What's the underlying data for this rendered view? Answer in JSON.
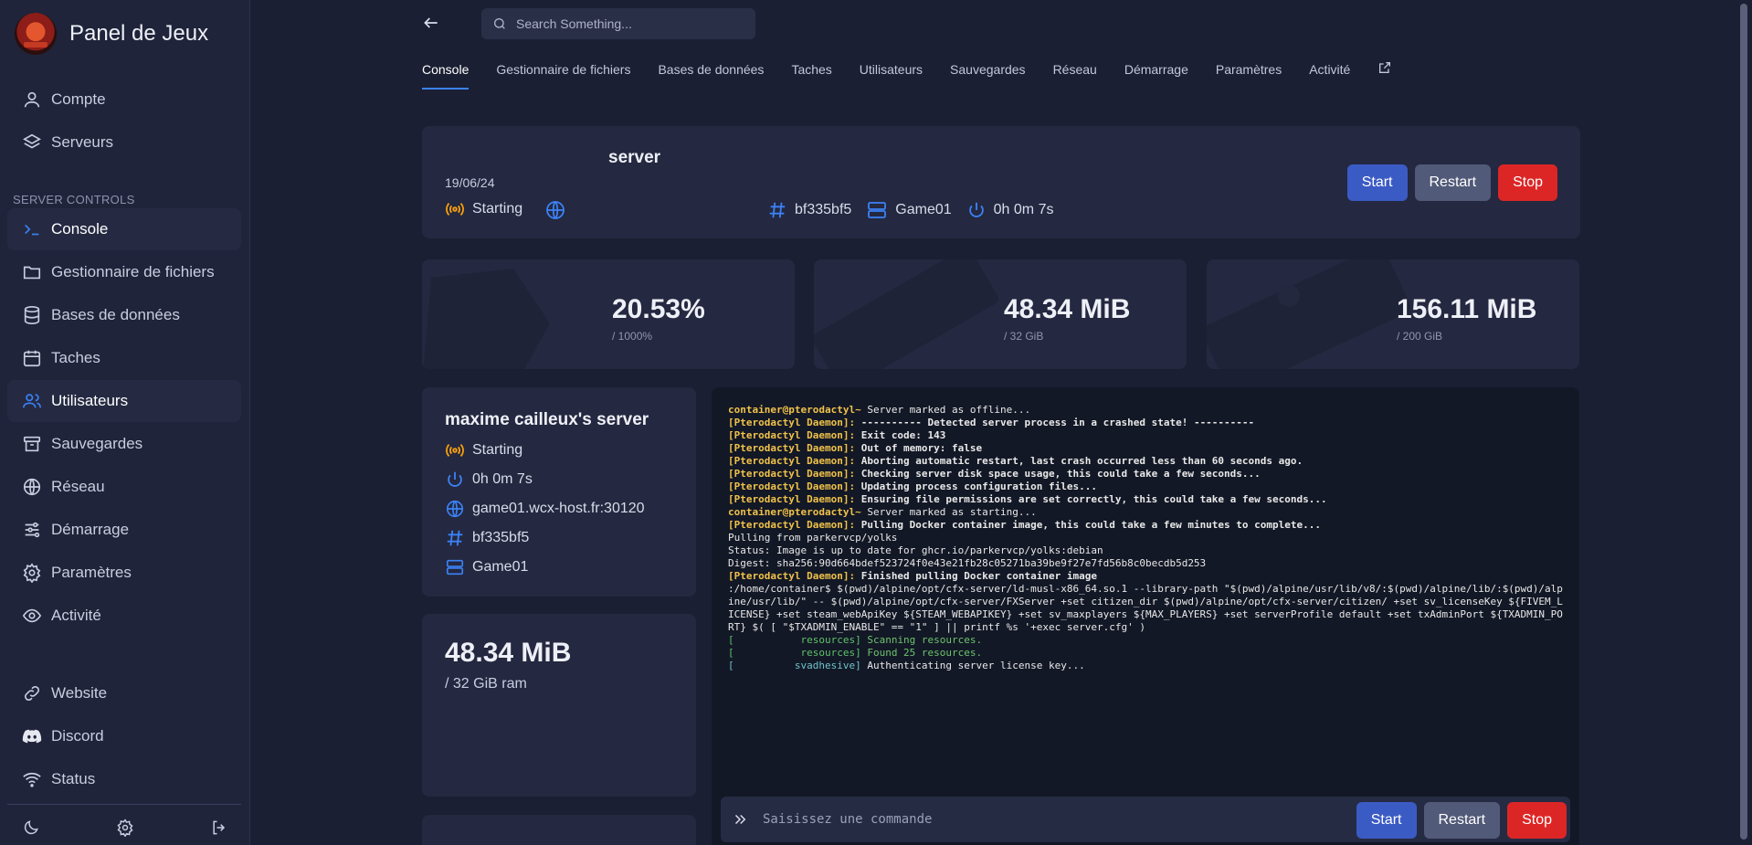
{
  "brand": {
    "title": "Panel de Jeux"
  },
  "sidebar": {
    "top_items": [
      {
        "label": "Compte",
        "icon": "user-icon"
      },
      {
        "label": "Serveurs",
        "icon": "layers-icon"
      }
    ],
    "section_label": "SERVER CONTROLS",
    "items": [
      {
        "label": "Console",
        "icon": "terminal-icon",
        "active": true
      },
      {
        "label": "Gestionnaire de fichiers",
        "icon": "folder-icon"
      },
      {
        "label": "Bases de données",
        "icon": "database-icon"
      },
      {
        "label": "Taches",
        "icon": "calendar-icon"
      },
      {
        "label": "Utilisateurs",
        "icon": "users-icon",
        "highlight": true
      },
      {
        "label": "Sauvegardes",
        "icon": "archive-icon"
      },
      {
        "label": "Réseau",
        "icon": "globe-icon"
      },
      {
        "label": "Démarrage",
        "icon": "sliders-icon"
      },
      {
        "label": "Paramètres",
        "icon": "gear-icon"
      },
      {
        "label": "Activité",
        "icon": "eye-icon"
      }
    ],
    "footer_items": [
      {
        "label": "Website",
        "icon": "link-icon"
      },
      {
        "label": "Discord",
        "icon": "discord-icon"
      },
      {
        "label": "Status",
        "icon": "wifi-icon"
      }
    ]
  },
  "search": {
    "placeholder": "Search Something..."
  },
  "tabs": [
    "Console",
    "Gestionnaire de fichiers",
    "Bases de données",
    "Taches",
    "Utilisateurs",
    "Sauvegardes",
    "Réseau",
    "Démarrage",
    "Paramètres",
    "Activité"
  ],
  "header": {
    "name": "server",
    "date": "19/06/24",
    "status": "Starting",
    "id": "bf335bf5",
    "node": "Game01",
    "uptime": "0h 0m 7s",
    "buttons": {
      "start": "Start",
      "restart": "Restart",
      "stop": "Stop"
    }
  },
  "stats": [
    {
      "value": "20.53%",
      "sub": "/ 1000%"
    },
    {
      "value": "48.34 MiB",
      "sub": "/ 32 GiB"
    },
    {
      "value": "156.11 MiB",
      "sub": "/ 200 GiB"
    }
  ],
  "info": {
    "title": "maxime cailleux's server",
    "status": "Starting",
    "uptime": "0h 0m 7s",
    "address": "game01.wcx-host.fr:30120",
    "id": "bf335bf5",
    "node": "Game01"
  },
  "memory": {
    "value": "48.34 MiB",
    "sub": "/ 32 GiB ram"
  },
  "console": {
    "lines": [
      {
        "prefix": "container@pterodactyl~",
        "text": " Server marked as offline...",
        "style": "prompt"
      },
      {
        "prefix": "[Pterodactyl Daemon]:",
        "text": " ---------- Detected server process in a crashed state! ----------",
        "style": "daemon"
      },
      {
        "prefix": "[Pterodactyl Daemon]:",
        "text": " Exit code: 143",
        "style": "daemon"
      },
      {
        "prefix": "[Pterodactyl Daemon]:",
        "text": " Out of memory: false",
        "style": "daemon"
      },
      {
        "prefix": "[Pterodactyl Daemon]:",
        "text": " Aborting automatic restart, last crash occurred less than 60 seconds ago.",
        "style": "daemon"
      },
      {
        "prefix": "[Pterodactyl Daemon]:",
        "text": " Checking server disk space usage, this could take a few seconds...",
        "style": "daemon"
      },
      {
        "prefix": "[Pterodactyl Daemon]:",
        "text": " Updating process configuration files...",
        "style": "daemon"
      },
      {
        "prefix": "[Pterodactyl Daemon]:",
        "text": " Ensuring file permissions are set correctly, this could take a few seconds...",
        "style": "daemon"
      },
      {
        "prefix": "container@pterodactyl~",
        "text": " Server marked as starting...",
        "style": "prompt"
      },
      {
        "prefix": "[Pterodactyl Daemon]:",
        "text": " Pulling Docker container image, this could take a few minutes to complete...",
        "style": "daemon"
      },
      {
        "prefix": "",
        "text": "Pulling from parkervcp/yolks",
        "style": "plain"
      },
      {
        "prefix": "",
        "text": "Status: Image is up to date for ghcr.io/parkervcp/yolks:debian",
        "style": "plain"
      },
      {
        "prefix": "",
        "text": "Digest: sha256:90d664bdef523724f0e43e21fb28c05271ba39be9f27e7fd56b8c0becdb5d253",
        "style": "plain"
      },
      {
        "prefix": "[Pterodactyl Daemon]:",
        "text": " Finished pulling Docker container image",
        "style": "daemon"
      },
      {
        "prefix": "",
        "text": ":/home/container$ $(pwd)/alpine/opt/cfx-server/ld-musl-x86_64.so.1 --library-path \"$(pwd)/alpine/usr/lib/v8/:$(pwd)/alpine/lib/:$(pwd)/alpine/usr/lib/\" -- $(pwd)/alpine/opt/cfx-server/FXServer +set citizen_dir $(pwd)/alpine/opt/cfx-server/citizen/ +set sv_licenseKey ${FIVEM_LICENSE} +set steam_webApiKey ${STEAM_WEBAPIKEY} +set sv_maxplayers ${MAX_PLAYERS} +set serverProfile default +set txAdminPort ${TXADMIN_PORT} $( [ \"$TXADMIN_ENABLE\" == \"1\" ] || printf %s '+exec server.cfg' )",
        "style": "plain"
      },
      {
        "prefix": "[           resources]",
        "text": " Scanning resources.",
        "style": "green"
      },
      {
        "prefix": "[           resources]",
        "text": " Found 25 resources.",
        "style": "green"
      },
      {
        "prefix": "[          svadhesive]",
        "text": " Authenticating server license key...",
        "style": "cyan"
      }
    ],
    "input_placeholder": "Saisissez une commande",
    "buttons": {
      "start": "Start",
      "restart": "Restart",
      "stop": "Stop"
    }
  },
  "colors": {
    "accent": "#3b82f6",
    "status_starting": "#f59e0b",
    "start": "#3b5bc4",
    "restart": "#515a78",
    "stop": "#dc2626"
  }
}
